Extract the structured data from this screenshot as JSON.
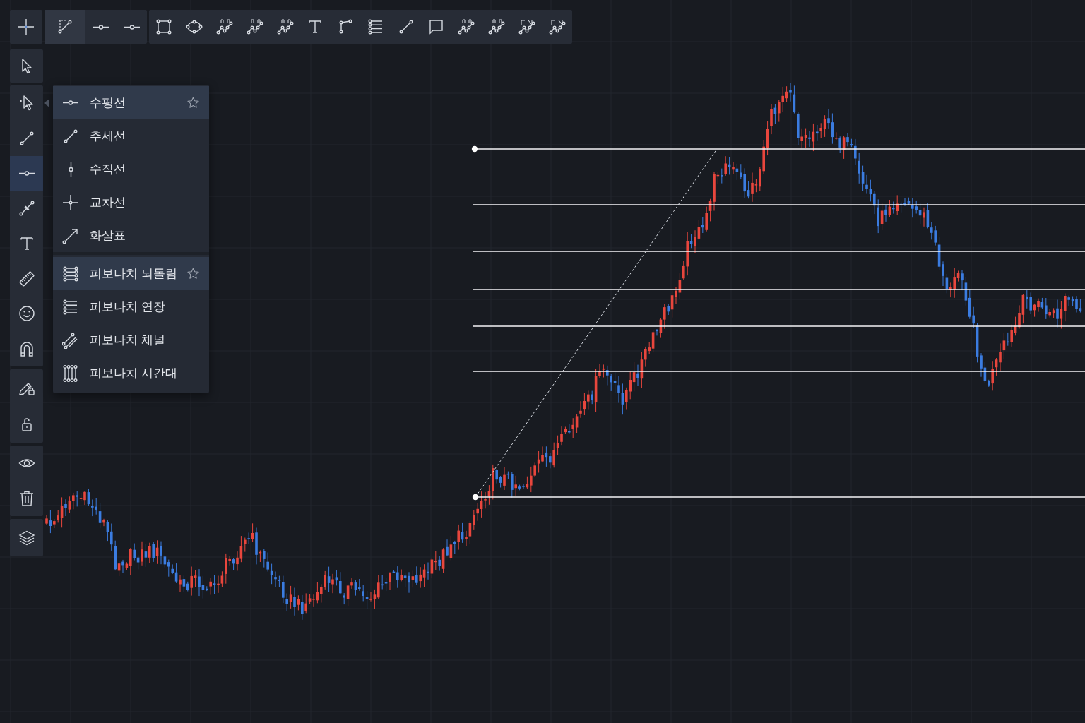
{
  "top_toolbar": {
    "groups": [
      {
        "items": [
          {
            "selected": false
          }
        ]
      },
      {
        "items": [
          {
            "selected": true
          },
          {
            "selected": false
          },
          {
            "selected": false
          }
        ]
      },
      {
        "items": [
          {
            "selected": false
          },
          {
            "selected": false
          },
          {
            "selected": false
          },
          {
            "selected": false
          },
          {
            "selected": false
          },
          {
            "selected": false
          },
          {
            "selected": false
          },
          {
            "selected": false
          },
          {
            "selected": false
          },
          {
            "selected": false
          },
          {
            "selected": false
          },
          {
            "selected": false
          },
          {
            "selected": false
          },
          {
            "selected": false
          }
        ]
      }
    ]
  },
  "left_toolbar": {
    "groups": [
      {
        "items": [
          {
            "selected": false
          }
        ]
      },
      {
        "items": [
          {
            "selected": false
          },
          {
            "selected": false
          },
          {
            "selected": true
          },
          {
            "selected": false
          },
          {
            "selected": false
          },
          {
            "selected": false
          },
          {
            "selected": false
          },
          {
            "selected": false
          }
        ]
      },
      {
        "items": [
          {
            "selected": false
          },
          {
            "selected": false
          }
        ]
      },
      {
        "items": [
          {
            "selected": false
          },
          {
            "selected": false
          }
        ]
      },
      {
        "items": [
          {
            "selected": false
          }
        ]
      }
    ]
  },
  "tool_menu": {
    "sections": [
      {
        "items": [
          {
            "label": "수평선",
            "selected": true
          },
          {
            "label": "추세선",
            "selected": false
          },
          {
            "label": "수직선",
            "selected": false
          },
          {
            "label": "교차선",
            "selected": false
          },
          {
            "label": "화살표",
            "selected": false
          }
        ]
      },
      {
        "items": [
          {
            "label": "피보나치 되돌림",
            "selected": true
          },
          {
            "label": "피보나치 연장",
            "selected": false
          },
          {
            "label": "피보나치 채널",
            "selected": false
          },
          {
            "label": "피보나치 시간대",
            "selected": false
          }
        ]
      }
    ]
  }
}
